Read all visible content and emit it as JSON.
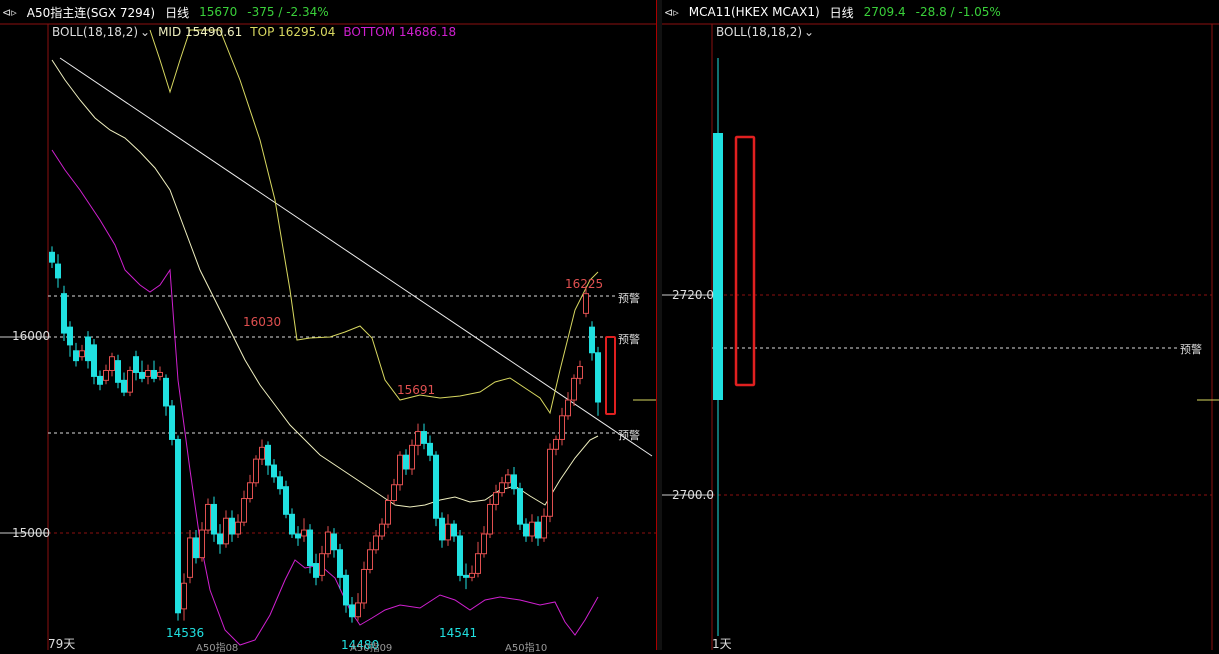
{
  "left": {
    "header": {
      "icon": "double-chevron-icon",
      "title": "A50指主连(SGX 7294)",
      "period": "日线",
      "price": "15670",
      "change": "-375 / -2.34%"
    },
    "boll": {
      "label": "BOLL(18,18,2)",
      "mid": "MID 15490.61",
      "top": "TOP 16295.04",
      "bottom": "BOTTOM 14686.18"
    },
    "y_axis": [
      "16000",
      "15000"
    ],
    "bottom_left": "79天",
    "markers": [
      "A50指08",
      "A50指09",
      "A50指10"
    ],
    "annotations": [
      "16030",
      "15691",
      "16225",
      "14536",
      "14480",
      "14541"
    ],
    "alert_label": "预警"
  },
  "right": {
    "header": {
      "icon": "double-chevron-icon",
      "title": "MCA11(HKEX MCAX1)",
      "period": "日线",
      "price": "2709.4",
      "change": "-28.8 / -1.05%"
    },
    "boll": {
      "label": "BOLL(18,18,2)"
    },
    "y_axis": [
      "2720.0",
      "2700.0"
    ],
    "bottom_left": "1天",
    "alert_label": "预警"
  },
  "colors": {
    "up": "#e05050",
    "down": "#20e0e0",
    "mid": "#f0f0c0",
    "top": "#d8d860",
    "bottom": "#d020d0",
    "grid": "#8b1010"
  }
}
